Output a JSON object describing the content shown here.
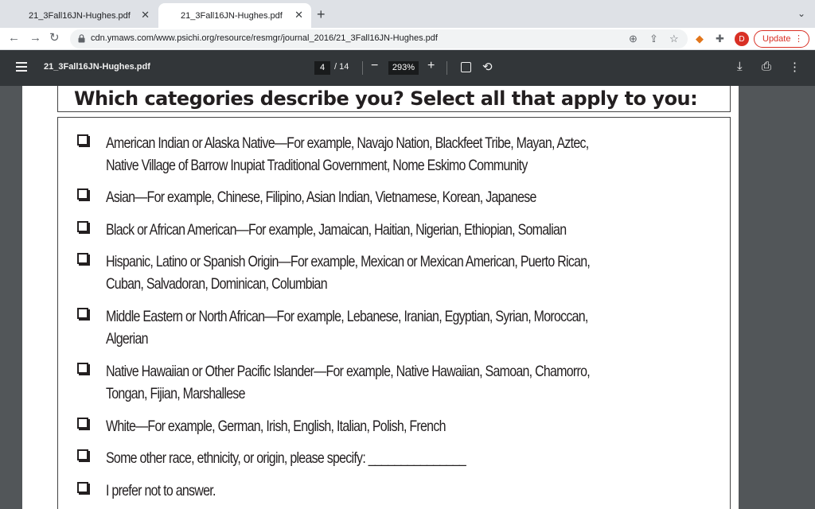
{
  "browser": {
    "tabs": [
      {
        "title": "21_3Fall16JN-Hughes.pdf",
        "active": false
      },
      {
        "title": "21_3Fall16JN-Hughes.pdf",
        "active": true
      }
    ],
    "url": "cdn.ymaws.com/www.psichi.org/resource/resmgr/journal_2016/21_3Fall16JN-Hughes.pdf",
    "profile_initial": "D",
    "update_label": "Update"
  },
  "pdf": {
    "title": "21_3Fall16JN-Hughes.pdf",
    "page_current": "4",
    "page_total": "/ 14",
    "zoom": "293%"
  },
  "document": {
    "heading": "Which categories describe you? Select all that apply to you:",
    "options": [
      {
        "line1": "American Indian or Alaska Native—For example, Navajo Nation, Blackfeet Tribe, Mayan, Aztec,",
        "line2": "Native Village of Barrow Inupiat Traditional Government, Nome Eskimo Community"
      },
      {
        "line1": "Asian—For example, Chinese, Filipino, Asian Indian, Vietnamese, Korean, Japanese",
        "line2": ""
      },
      {
        "line1": "Black or African American—For example, Jamaican, Haitian, Nigerian, Ethiopian, Somalian",
        "line2": ""
      },
      {
        "line1": "Hispanic, Latino or Spanish Origin—For example, Mexican or Mexican American, Puerto Rican,",
        "line2": "Cuban, Salvadoran, Dominican, Columbian"
      },
      {
        "line1": "Middle Eastern or North African—For example, Lebanese, Iranian, Egyptian, Syrian, Moroccan,",
        "line2": "Algerian"
      },
      {
        "line1": "Native Hawaiian or Other Pacific Islander—For example, Native Hawaiian, Samoan, Chamorro,",
        "line2": "Tongan, Fijian, Marshallese"
      },
      {
        "line1": "White—For example, German, Irish, English, Italian, Polish, French",
        "line2": ""
      },
      {
        "line1": "Some other race, ethnicity, or origin, please specify: _______________",
        "line2": ""
      },
      {
        "line1": "I prefer not to answer.",
        "line2": ""
      }
    ]
  },
  "colors": {
    "pdf_toolbar": "#323639",
    "viewer_background": "#525659",
    "update_accent": "#d93025"
  }
}
